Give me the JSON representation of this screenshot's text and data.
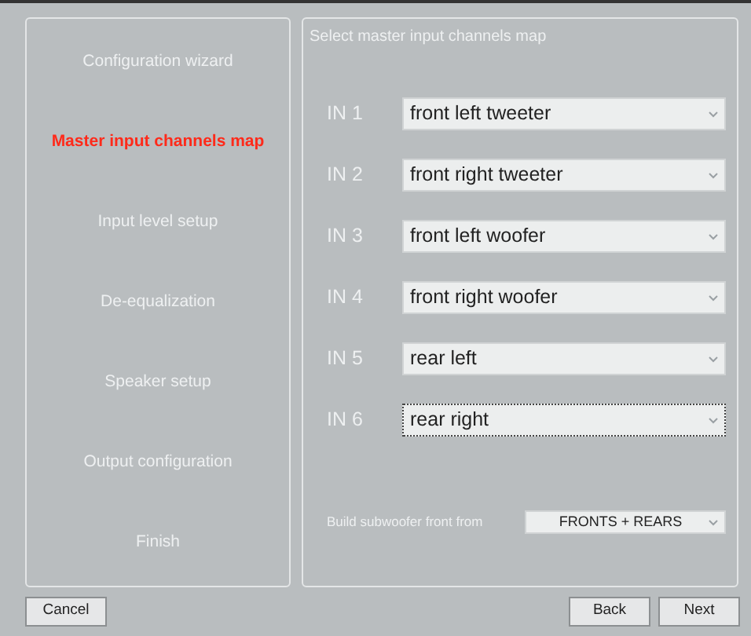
{
  "steps": [
    {
      "label": "Configuration wizard",
      "selected": false
    },
    {
      "label": "Master input channels map",
      "selected": true
    },
    {
      "label": "Input level setup",
      "selected": false
    },
    {
      "label": "De-equalization",
      "selected": false
    },
    {
      "label": "Speaker setup",
      "selected": false
    },
    {
      "label": "Output configuration",
      "selected": false
    },
    {
      "label": "Finish",
      "selected": false
    }
  ],
  "panel": {
    "title": "Select master input channels map",
    "channels": [
      {
        "label": "IN 1",
        "value": "front left tweeter",
        "focused": false
      },
      {
        "label": "IN 2",
        "value": "front right tweeter",
        "focused": false
      },
      {
        "label": "IN 3",
        "value": "front left woofer",
        "focused": false
      },
      {
        "label": "IN 4",
        "value": "front right woofer",
        "focused": false
      },
      {
        "label": "IN 5",
        "value": "rear left",
        "focused": false
      },
      {
        "label": "IN 6",
        "value": "rear right",
        "focused": true
      }
    ],
    "subwoofer": {
      "label": "Build subwoofer front from",
      "value": "FRONTS + REARS"
    }
  },
  "buttons": {
    "cancel": "Cancel",
    "back": "Back",
    "next": "Next"
  }
}
